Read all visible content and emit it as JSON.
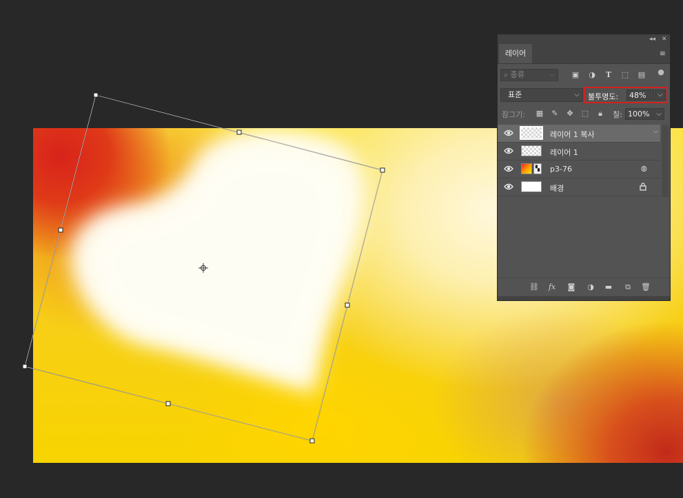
{
  "panel": {
    "tab_label": "레이어",
    "filter": {
      "kind_label": "종류"
    },
    "blend_mode": "표준",
    "opacity": {
      "label": "불투명도:",
      "value": "48%"
    },
    "lock": {
      "label": "잠그기:"
    },
    "fill": {
      "label": "칠:",
      "value": "100%"
    },
    "layers": [
      {
        "name": "레이어 1 복사",
        "visible": true,
        "selected": true,
        "type": "transparent"
      },
      {
        "name": "레이어 1",
        "visible": true,
        "selected": false,
        "type": "transparent"
      },
      {
        "name": "p3-76",
        "visible": true,
        "selected": false,
        "type": "smart-object"
      },
      {
        "name": "배경",
        "visible": true,
        "selected": false,
        "type": "background",
        "locked": true
      }
    ]
  },
  "colors": {
    "app_bg": "#282828",
    "panel_bg": "#535353",
    "panel_header": "#424242",
    "selected_layer": "#6a6a6a",
    "highlight_box": "#d52020"
  },
  "icons": {
    "filter": [
      "image-filter-icon",
      "adjustment-filter-icon",
      "type-filter-icon",
      "shape-filter-icon",
      "smart-object-filter-icon",
      "filter-toggle-icon"
    ],
    "lock": [
      "lock-transparent-icon",
      "lock-paint-icon",
      "lock-position-icon",
      "lock-artboard-icon",
      "lock-all-icon"
    ],
    "bottom": [
      "link-layers-icon",
      "fx-icon",
      "add-mask-icon",
      "adjustment-layer-icon",
      "new-group-icon",
      "new-layer-icon",
      "delete-layer-icon"
    ]
  }
}
